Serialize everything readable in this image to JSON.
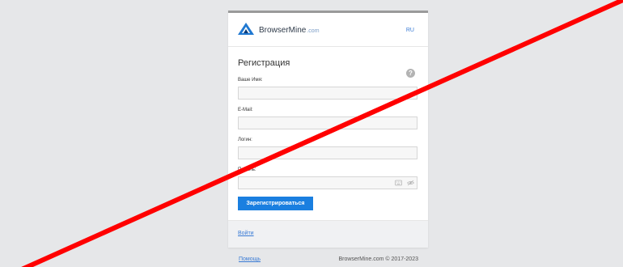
{
  "header": {
    "brand_name": "BrowserMine",
    "brand_suffix": ".com",
    "language": "RU"
  },
  "form": {
    "title": "Регистрация",
    "help_icon": "?",
    "fields": [
      {
        "label": "Ваше Имя:",
        "value": "",
        "placeholder": ""
      },
      {
        "label": "E-Mail:",
        "value": "",
        "placeholder": ""
      },
      {
        "label": "Логин:",
        "value": "",
        "placeholder": ""
      },
      {
        "label": "Пароль:",
        "value": "",
        "placeholder": ""
      }
    ],
    "submit_label": "Зарегистрироваться"
  },
  "footer": {
    "login_link": "Войти"
  },
  "page_footer": {
    "help_link": "Помощь",
    "copyright": "BrowserMine.com © 2017-2023"
  },
  "colors": {
    "page_background": "#e6e7e9",
    "accent": "#1a7fe0",
    "link": "#3a7bd5",
    "overlay_line": "#ff0000"
  },
  "icons": [
    "logo-icon",
    "help-icon",
    "keyboard-icon",
    "eye-hidden-icon"
  ]
}
